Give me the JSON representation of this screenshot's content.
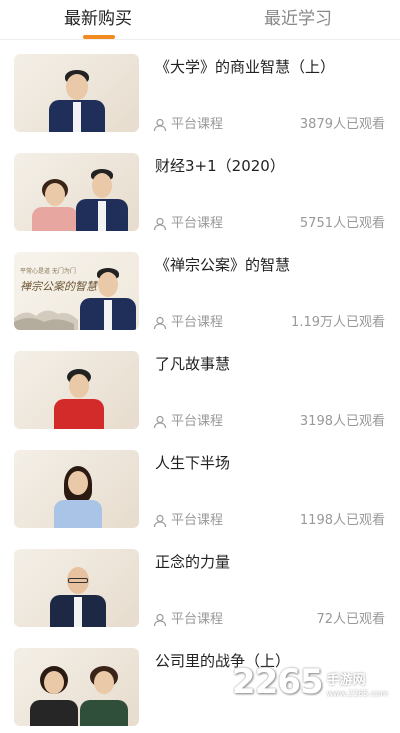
{
  "tabs": [
    {
      "label": "最新购买",
      "active": true
    },
    {
      "label": "最近学习",
      "active": false
    }
  ],
  "accent_color": "#f08a21",
  "courses": [
    {
      "title": "《大学》的商业智慧（上）",
      "tag": "平台课程",
      "views": "3879人已观看",
      "thumb": "single-male-lecturer"
    },
    {
      "title": "财经3+1（2020）",
      "tag": "平台课程",
      "views": "5751人已观看",
      "thumb": "female-and-male-lecturers"
    },
    {
      "title": "《禅宗公案》的智慧",
      "tag": "平台课程",
      "views": "1.19万人已观看",
      "thumb": "calligraphy-with-lecturer"
    },
    {
      "title": "了凡故事慧",
      "tag": "平台课程",
      "views": "3198人已观看",
      "thumb": "female-lecturer-red"
    },
    {
      "title": "人生下半场",
      "tag": "平台课程",
      "views": "1198人已观看",
      "thumb": "female-lecturer-blue"
    },
    {
      "title": "正念的力量",
      "tag": "平台课程",
      "views": "72人已观看",
      "thumb": "bald-male-lecturer"
    },
    {
      "title": "公司里的战争（上）",
      "tag": "平台课程",
      "views": "",
      "thumb": "two-female-lecturers"
    }
  ],
  "thumb_text": {
    "calligraphy_title": "禅宗公案的智慧",
    "calligraphy_small": "平常心是道 无门为门"
  },
  "watermark": {
    "number": "2265",
    "site": "手游网",
    "url": "www.2265.com"
  }
}
